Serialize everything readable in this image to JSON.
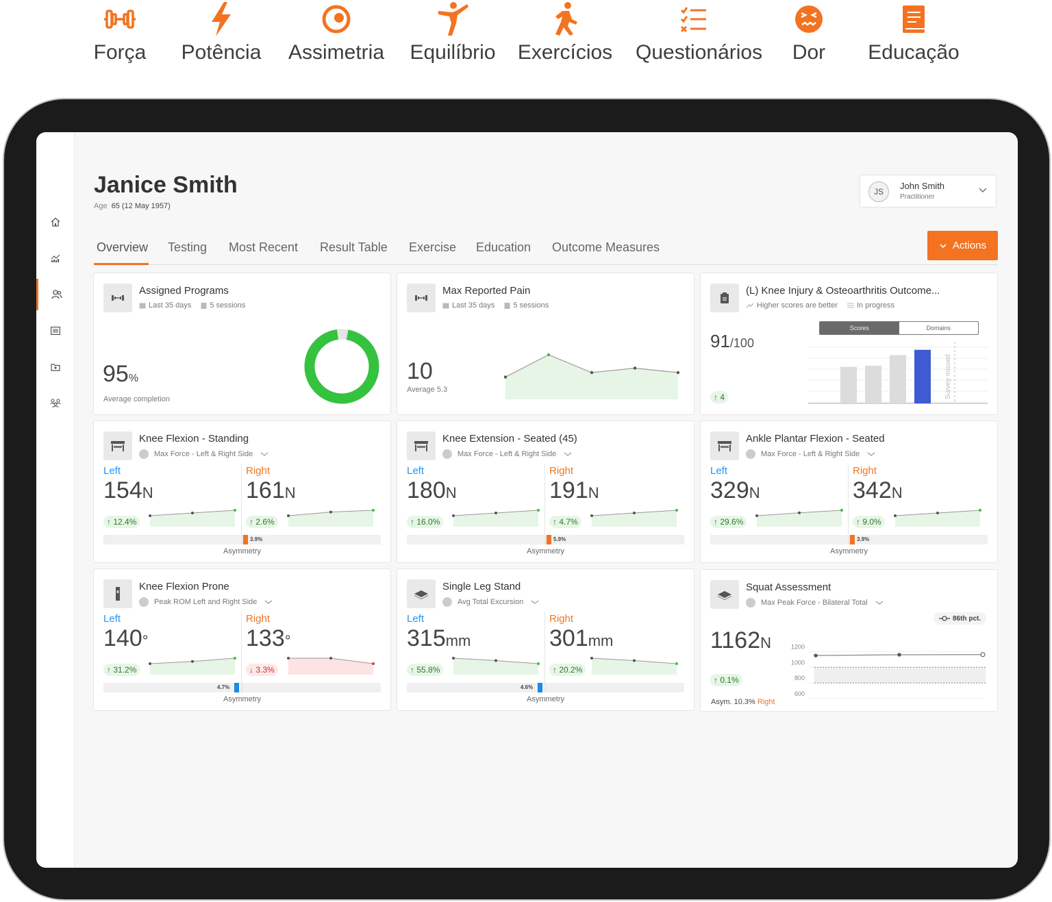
{
  "features": [
    {
      "label": "Força",
      "icon": "dumbbell-icon"
    },
    {
      "label": "Potência",
      "icon": "lightning-icon"
    },
    {
      "label": "Assimetria",
      "icon": "asymmetry-icon"
    },
    {
      "label": "Equilíbrio",
      "icon": "balance-person-icon"
    },
    {
      "label": "Exercícios",
      "icon": "running-person-icon"
    },
    {
      "label": "Questionários",
      "icon": "checklist-icon"
    },
    {
      "label": "Dor",
      "icon": "pain-face-icon"
    },
    {
      "label": "Educação",
      "icon": "book-icon"
    }
  ],
  "accent_color": "#f37321",
  "patient": {
    "name": "Janice Smith",
    "age_label": "Age",
    "age_value": "65 (12 May 1957)"
  },
  "user": {
    "initials": "JS",
    "name": "John Smith",
    "role": "Practitioner"
  },
  "tabs": [
    "Overview",
    "Testing",
    "Most Recent",
    "Result Table",
    "Exercise",
    "Education",
    "Outcome Measures"
  ],
  "actions_label": "Actions",
  "sidebar_icons": [
    "home-icon",
    "analytics-icon",
    "patients-icon",
    "list-icon",
    "folder-icon",
    "groups-icon"
  ],
  "programs": {
    "title": "Assigned Programs",
    "period": "Last 35 days",
    "sessions": "5 sessions",
    "value": "95",
    "unit": "%",
    "caption": "Average completion",
    "completion": 0.95
  },
  "pain": {
    "title": "Max Reported Pain",
    "period": "Last 35 days",
    "sessions": "5 sessions",
    "value": "10",
    "caption": "Average  5.3",
    "series": [
      5,
      10,
      6,
      7,
      6
    ]
  },
  "koos": {
    "title": "(L) Knee Injury & Osteoarthritis Outcome...",
    "note": "Higher scores are better",
    "status": "In progress",
    "value": "91",
    "of": "/100",
    "change": "4",
    "tab_scores": "Scores",
    "tab_domains": "Domains",
    "bars": [
      62,
      64,
      82,
      91
    ],
    "missed_label": "Survey missed"
  },
  "strength_cards": [
    {
      "title": "Knee Flexion - Standing",
      "metric": "Max Force - Left & Right Side",
      "left_label": "Left",
      "left_value": "154",
      "left_unit": "N",
      "left_change": "12.4%",
      "left_dir": "up",
      "right_label": "Right",
      "right_value": "161",
      "right_unit": "N",
      "right_change": "2.6%",
      "right_dir": "up",
      "asym_value": "3.9%",
      "asym_side": "right",
      "asym_label": "Asymmetry",
      "left_series": [
        150,
        152,
        154
      ],
      "right_series": [
        158,
        160,
        161
      ]
    },
    {
      "title": "Knee Extension - Seated (45)",
      "metric": "Max Force - Left & Right Side",
      "left_label": "Left",
      "left_value": "180",
      "left_unit": "N",
      "left_change": "16.0%",
      "left_dir": "up",
      "right_label": "Right",
      "right_value": "191",
      "right_unit": "N",
      "right_change": "4.7%",
      "right_dir": "up",
      "asym_value": "5.9%",
      "asym_side": "right",
      "asym_label": "Asymmetry",
      "left_series": [
        170,
        175,
        180
      ],
      "right_series": [
        189,
        190,
        191
      ]
    },
    {
      "title": "Ankle Plantar Flexion - Seated",
      "metric": "Max Force - Left & Right Side",
      "left_label": "Left",
      "left_value": "329",
      "left_unit": "N",
      "left_change": "29.6%",
      "left_dir": "up",
      "right_label": "Right",
      "right_value": "342",
      "right_unit": "N",
      "right_change": "9.0%",
      "right_dir": "up",
      "asym_value": "3.9%",
      "asym_side": "right",
      "asym_label": "Asymmetry",
      "left_series": [
        310,
        320,
        329
      ],
      "right_series": [
        340,
        341,
        342
      ]
    },
    {
      "title": "Knee Flexion Prone",
      "metric": "Peak ROM Left and Right Side",
      "left_label": "Left",
      "left_value": "140",
      "left_unit": "°",
      "left_change": "31.2%",
      "left_dir": "up",
      "right_label": "Right",
      "right_value": "133",
      "right_unit": "°",
      "right_change": "3.3%",
      "right_dir": "down",
      "asym_value": "4.7%",
      "asym_side": "left",
      "asym_label": "Asymmetry",
      "left_series": [
        120,
        128,
        140
      ],
      "right_series": [
        134,
        134,
        133
      ]
    },
    {
      "title": "Single Leg Stand",
      "metric": "Avg Total Excursion",
      "left_label": "Left",
      "left_value": "315",
      "left_unit": "mm",
      "left_change": "55.8%",
      "left_dir": "up",
      "right_label": "Right",
      "right_value": "301",
      "right_unit": "mm",
      "right_change": "20.2%",
      "right_dir": "up",
      "asym_value": "4.6%",
      "asym_side": "left",
      "asym_label": "Asymmetry",
      "left_series": [
        360,
        340,
        315
      ],
      "right_series": [
        310,
        306,
        301
      ]
    }
  ],
  "squat": {
    "title": "Squat Assessment",
    "metric": "Max Peak Force - Bilateral Total",
    "percentile": "86th pct.",
    "value": "1162",
    "unit": "N",
    "change": "0.1%",
    "asym_label": "Asym.",
    "asym_value": "10.3%",
    "asym_side": "Right",
    "y_ticks": [
      "1200",
      "1000",
      "800",
      "600"
    ],
    "series": [
      1150,
      1160,
      1162
    ],
    "band": [
      800,
      1000
    ]
  }
}
